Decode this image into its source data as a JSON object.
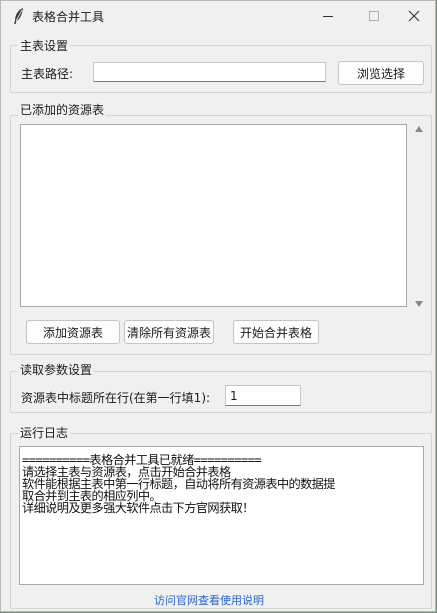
{
  "window": {
    "title": "表格合并工具",
    "controls": {
      "minimize": "minimize-icon",
      "maximize": "maximize-icon",
      "close": "close-icon"
    },
    "app_icon": "feather-icon"
  },
  "main_settings": {
    "group_label": "主表设置",
    "path_label": "主表路径:",
    "path_value": "",
    "browse_button": "浏览选择"
  },
  "resources": {
    "group_label": "已添加的资源表",
    "items": [],
    "add_button": "添加资源表",
    "clear_button": "清除所有资源表",
    "merge_button": "开始合并表格"
  },
  "read_params": {
    "group_label": "读取参数设置",
    "header_row_label": "资源表中标题所在行(在第一行填1):",
    "header_row_value": "1"
  },
  "log": {
    "group_label": "运行日志",
    "lines": [
      "==========表格合并工具已就绪==========",
      "请选择主表与资源表，点击开始合并表格",
      "软件能根据主表中第一行标题，自动将所有资源表中的数据提",
      "取合并到主表的相应列中。",
      "详细说明及更多强大软件点击下方官网获取！"
    ]
  },
  "footer": {
    "link_text": "访问官网查看使用说明"
  },
  "colors": {
    "link": "#2a64c8",
    "window_bg": "#f0f0f0"
  }
}
